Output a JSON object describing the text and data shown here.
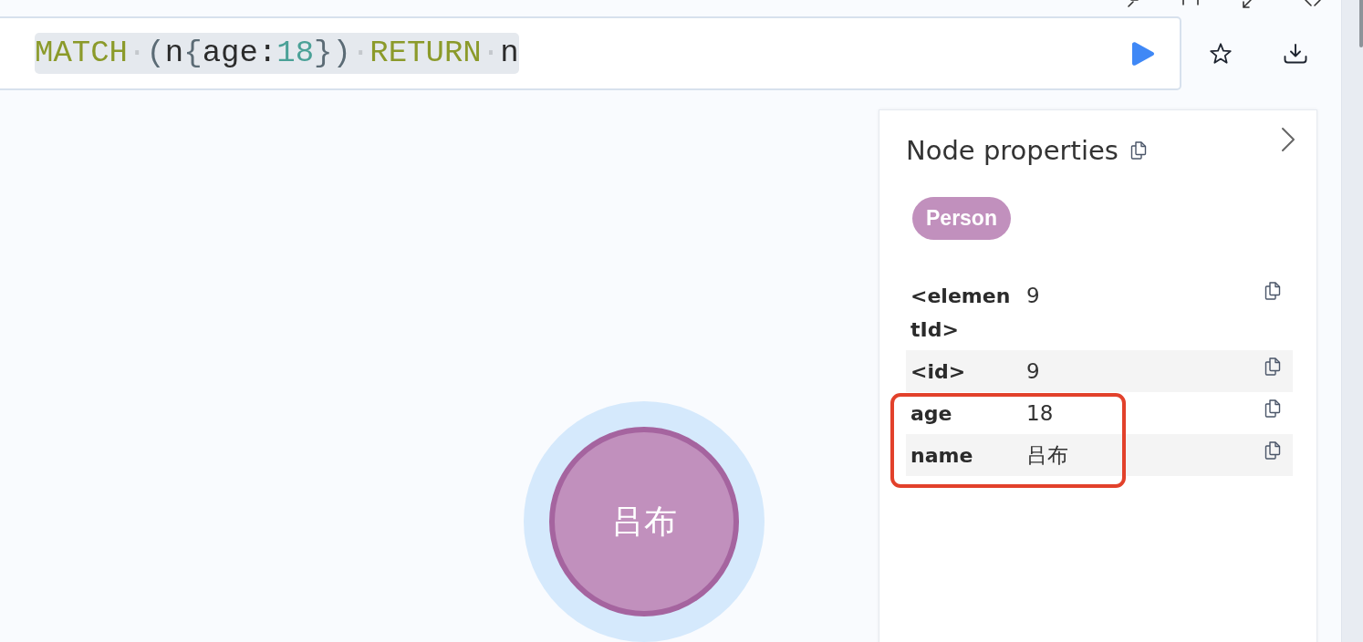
{
  "editor": {
    "tokens": [
      {
        "text": "MATCH",
        "kind": "keyword"
      },
      {
        "text": "·",
        "kind": "space"
      },
      {
        "text": "(",
        "kind": "bracket"
      },
      {
        "text": "n",
        "kind": "name"
      },
      {
        "text": "{",
        "kind": "bracket"
      },
      {
        "text": "age",
        "kind": "name"
      },
      {
        "text": ":",
        "kind": "name"
      },
      {
        "text": "18",
        "kind": "number"
      },
      {
        "text": "}",
        "kind": "bracket"
      },
      {
        "text": ")",
        "kind": "bracket"
      },
      {
        "text": "·",
        "kind": "space"
      },
      {
        "text": "RETURN",
        "kind": "keyword"
      },
      {
        "text": "·",
        "kind": "space"
      },
      {
        "text": "n",
        "kind": "name"
      }
    ]
  },
  "graph": {
    "nodes": [
      {
        "label": "吕布",
        "selected": true
      }
    ]
  },
  "properties_panel": {
    "title": "Node properties",
    "labels": [
      "Person"
    ],
    "rows": [
      {
        "key": "<elementId>",
        "value": "9",
        "highlighted": false
      },
      {
        "key": "<id>",
        "value": "9",
        "highlighted": false
      },
      {
        "key": "age",
        "value": "18",
        "highlighted": true
      },
      {
        "key": "name",
        "value": "吕布",
        "highlighted": true
      }
    ]
  }
}
